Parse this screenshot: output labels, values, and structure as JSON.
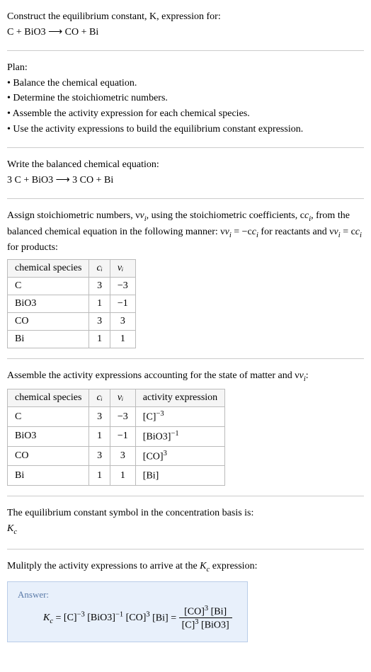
{
  "header": {
    "prompt_line1": "Construct the equilibrium constant, K, expression for:",
    "equation_unbalanced": "C + BiO3  ⟶  CO + Bi"
  },
  "plan": {
    "title": "Plan:",
    "items": [
      "• Balance the chemical equation.",
      "• Determine the stoichiometric numbers.",
      "• Assemble the activity expression for each chemical species.",
      "• Use the activity expressions to build the equilibrium constant expression."
    ]
  },
  "balanced": {
    "intro": "Write the balanced chemical equation:",
    "equation": "3 C + BiO3  ⟶  3 CO + Bi"
  },
  "stoich": {
    "intro_a": "Assign stoichiometric numbers, ν",
    "intro_b": ", using the stoichiometric coefficients, c",
    "intro_c": ", from the balanced chemical equation in the following manner: ν",
    "intro_d": " = −c",
    "intro_e": " for reactants and ν",
    "intro_f": " = c",
    "intro_g": " for products:",
    "headers": {
      "h1": "chemical species",
      "h2": "cᵢ",
      "h3": "νᵢ"
    },
    "rows": [
      {
        "species": "C",
        "ci": "3",
        "vi": "−3"
      },
      {
        "species": "BiO3",
        "ci": "1",
        "vi": "−1"
      },
      {
        "species": "CO",
        "ci": "3",
        "vi": "3"
      },
      {
        "species": "Bi",
        "ci": "1",
        "vi": "1"
      }
    ]
  },
  "activity": {
    "intro_a": "Assemble the activity expressions accounting for the state of matter and ν",
    "intro_b": ":",
    "headers": {
      "h1": "chemical species",
      "h2": "cᵢ",
      "h3": "νᵢ",
      "h4": "activity expression"
    },
    "rows": [
      {
        "species": "C",
        "ci": "3",
        "vi": "−3",
        "act_base": "[C]",
        "act_exp": "−3"
      },
      {
        "species": "BiO3",
        "ci": "1",
        "vi": "−1",
        "act_base": "[BiO3]",
        "act_exp": "−1"
      },
      {
        "species": "CO",
        "ci": "3",
        "vi": "3",
        "act_base": "[CO]",
        "act_exp": "3"
      },
      {
        "species": "Bi",
        "ci": "1",
        "vi": "1",
        "act_base": "[Bi]",
        "act_exp": ""
      }
    ]
  },
  "symbol_section": {
    "line1": "The equilibrium constant symbol in the concentration basis is:",
    "symbol_base": "K",
    "symbol_sub": "c"
  },
  "multiply": {
    "intro_a": "Mulitply the activity expressions to arrive at the ",
    "intro_b": " expression:",
    "k_base": "K",
    "k_sub": "c"
  },
  "answer": {
    "label": "Answer:",
    "lhs_base": "K",
    "lhs_sub": "c",
    "term1_base": "[C]",
    "term1_exp": "−3",
    "term2_base": "[BiO3]",
    "term2_exp": "−1",
    "term3_base": "[CO]",
    "term3_exp": "3",
    "term4_base": "[Bi]",
    "frac_num_a": "[CO]",
    "frac_num_a_exp": "3",
    "frac_num_b": " [Bi]",
    "frac_den_a": "[C]",
    "frac_den_a_exp": "3",
    "frac_den_b": " [BiO3]"
  },
  "chart_data": {
    "type": "table",
    "tables": [
      {
        "title": "Stoichiometric numbers",
        "columns": [
          "chemical species",
          "c_i",
          "ν_i"
        ],
        "rows": [
          [
            "C",
            3,
            -3
          ],
          [
            "BiO3",
            1,
            -1
          ],
          [
            "CO",
            3,
            3
          ],
          [
            "Bi",
            1,
            1
          ]
        ]
      },
      {
        "title": "Activity expressions",
        "columns": [
          "chemical species",
          "c_i",
          "ν_i",
          "activity expression"
        ],
        "rows": [
          [
            "C",
            3,
            -3,
            "[C]^-3"
          ],
          [
            "BiO3",
            1,
            -1,
            "[BiO3]^-1"
          ],
          [
            "CO",
            3,
            3,
            "[CO]^3"
          ],
          [
            "Bi",
            1,
            1,
            "[Bi]"
          ]
        ]
      }
    ]
  }
}
